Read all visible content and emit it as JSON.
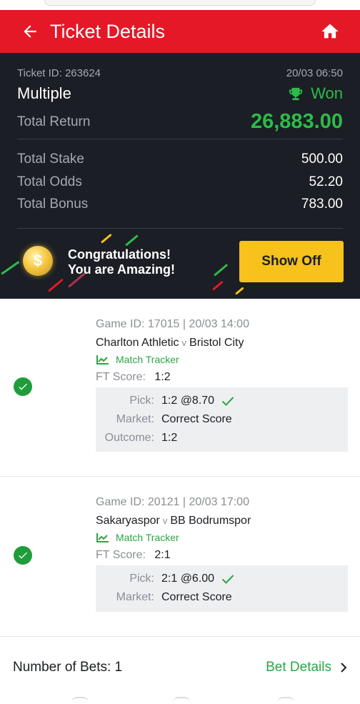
{
  "header": {
    "title": "Ticket Details",
    "back_icon": "arrow-left-icon",
    "home_icon": "home-icon"
  },
  "ticket": {
    "id_label": "Ticket ID: 263624",
    "date": "20/03 06:50",
    "type": "Multiple",
    "status": "Won",
    "total_return_label": "Total Return",
    "total_return": "26,883.00",
    "total_stake_label": "Total Stake",
    "total_stake": "500.00",
    "total_odds_label": "Total Odds",
    "total_odds": "52.20",
    "total_bonus_label": "Total Bonus",
    "total_bonus": "783.00"
  },
  "banner": {
    "line1": "Congratulations!",
    "line2": "You are Amazing!",
    "button": "Show Off",
    "coin_symbol": "$"
  },
  "bets": [
    {
      "game": "Game ID: 17015 | 20/03 14:00",
      "home": "Charlton Athletic",
      "vs": "v",
      "away": "Bristol City",
      "tracker": "Match Tracker",
      "ft_label": "FT Score:",
      "ft_score": "1:2",
      "pick_label": "Pick:",
      "pick": "1:2 @8.70",
      "market_label": "Market:",
      "market": "Correct Score",
      "outcome_label": "Outcome:",
      "outcome": "1:2"
    },
    {
      "game": "Game ID: 20121 | 20/03 17:00",
      "home": "Sakaryaspor",
      "vs": "v",
      "away": "BB Bodrumspor",
      "tracker": "Match Tracker",
      "ft_label": "FT Score:",
      "ft_score": "2:1",
      "pick_label": "Pick:",
      "pick": "2:1 @6.00",
      "market_label": "Market:",
      "market": "Correct Score"
    }
  ],
  "footer": {
    "num_bets": "Number of Bets: 1",
    "bet_details": "Bet Details"
  },
  "colors": {
    "brand_red": "#e41827",
    "win_green": "#2dbb49",
    "dark_bg": "#1b1e24",
    "button_yellow": "#f6c21b"
  }
}
